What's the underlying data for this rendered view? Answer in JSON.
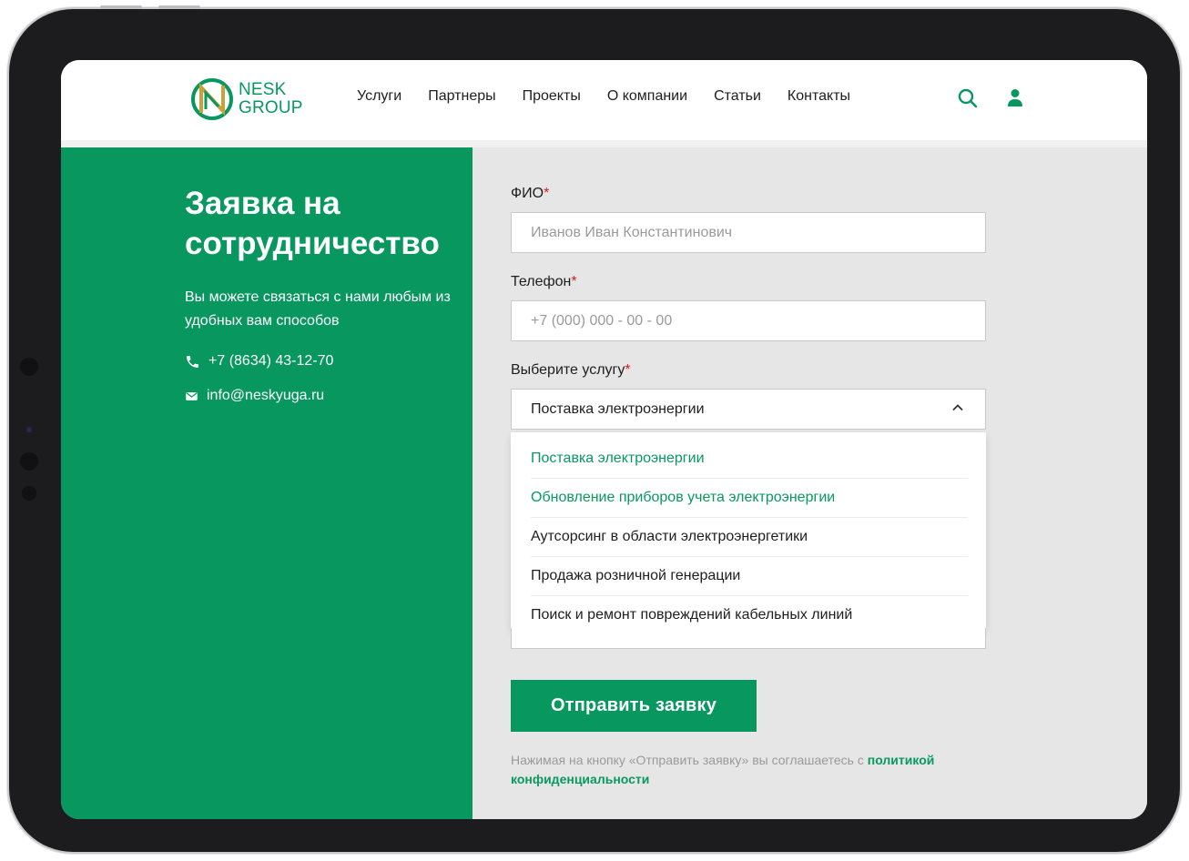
{
  "header": {
    "logo": {
      "line1": "NESK",
      "line2": "GROUP",
      "letter": "N"
    },
    "nav": [
      "Услуги",
      "Партнеры",
      "Проекты",
      "О компании",
      "Статьи",
      "Контакты"
    ],
    "icons": [
      "search-icon",
      "user-icon"
    ]
  },
  "left": {
    "title": "Заявка на сотрудничество",
    "text": "Вы можете связаться с нами любым из удобных вам способов",
    "phone": "+7 (8634) 43-12-70",
    "email": "info@neskyuga.ru"
  },
  "form": {
    "fio_label": "ФИО",
    "fio_placeholder": "Иванов Иван Константинович",
    "phone_label": "Телефон",
    "phone_placeholder": "+7 (000) 000 - 00 - 00",
    "service_label": "Выберите услугу",
    "required_mark": "*",
    "service_selected": "Поставка электроэнергии",
    "service_options": [
      "Поставка электроэнергии",
      "Обновление приборов учета электроэнергии",
      "Аутсорсинг в области электроэнергетики",
      "Продажа розничной генерации",
      "Поиск и ремонт повреждений кабельных линий"
    ],
    "submit_label": "Отправить заявку",
    "consent_text": "Нажимая на кнопку «Отправить заявку» вы соглашаетесь с ",
    "consent_link": "политикой конфиденциальности"
  },
  "colors": {
    "brand": "#07975f",
    "required": "#e11d1d",
    "gold": "#c9a13b"
  }
}
